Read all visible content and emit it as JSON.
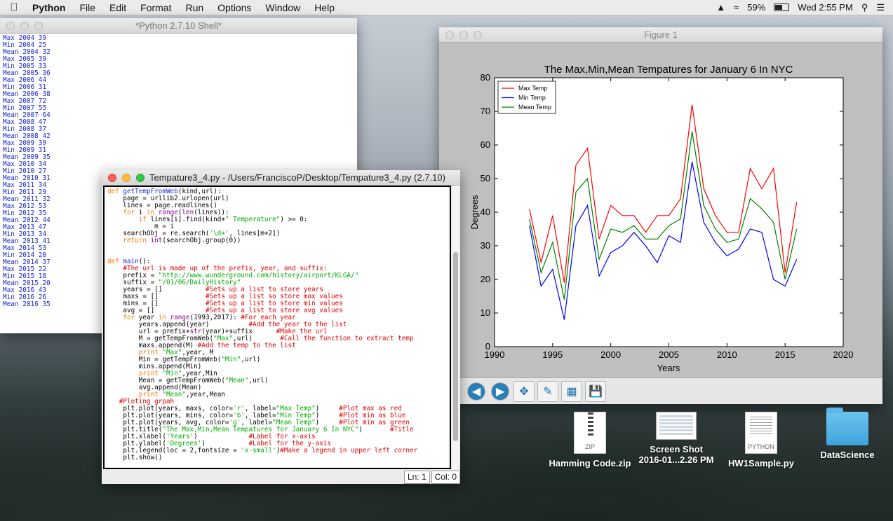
{
  "menubar": {
    "app_name": "Python",
    "items": [
      "File",
      "Edit",
      "Format",
      "Run",
      "Options",
      "Window",
      "Help"
    ],
    "battery": "59%",
    "clock": "Wed 2:55 PM"
  },
  "shell": {
    "title": "*Python 2.7.10 Shell*",
    "lines": [
      "Max 2004 39",
      "Min 2004 25",
      "Mean 2004 32",
      "Max 2005 39",
      "Min 2005 33",
      "Mean 2005 36",
      "Max 2006 44",
      "Min 2006 31",
      "Mean 2006 38",
      "Max 2007 72",
      "Min 2007 55",
      "Mean 2007 64",
      "Max 2008 47",
      "Min 2008 37",
      "Mean 2008 42",
      "Max 2009 39",
      "Min 2009 31",
      "Mean 2009 35",
      "Max 2010 34",
      "Min 2010 27",
      "Mean 2010 31",
      "Max 2011 34",
      "Min 2011 29",
      "Mean 2011 32",
      "Max 2012 53",
      "Min 2012 35",
      "Mean 2012 44",
      "Max 2013 47",
      "Min 2013 34",
      "Mean 2013 41",
      "Max 2014 53",
      "Min 2014 20",
      "Mean 2014 37",
      "Max 2015 22",
      "Min 2015 18",
      "Mean 2015 20",
      "Max 2016 43",
      "Min 2016 26",
      "Mean 2016 35"
    ]
  },
  "editor": {
    "title": "Tempature3_4.py - /Users/FranciscoP/Desktop/Tempature3_4.py (2.7.10)",
    "status_line": "Ln: 1",
    "status_col": "Col: 0",
    "code": [
      [
        [
          "kw",
          "def "
        ],
        [
          "fn",
          "getTempFromWeb"
        ],
        [
          "t",
          "(kind,url):"
        ]
      ],
      [
        [
          "t",
          "    page = urllib2.urlopen(url)"
        ]
      ],
      [
        [
          "t",
          "    lines = page.readlines()"
        ]
      ],
      [
        [
          "t",
          "    "
        ],
        [
          "kw",
          "for"
        ],
        [
          "t",
          " i "
        ],
        [
          "kw",
          "in"
        ],
        [
          "t",
          " "
        ],
        [
          "bi",
          "range"
        ],
        [
          "t",
          "("
        ],
        [
          "bi",
          "len"
        ],
        [
          "t",
          "(lines)):"
        ]
      ],
      [
        [
          "t",
          "        "
        ],
        [
          "kw",
          "if"
        ],
        [
          "t",
          " lines[i].find(kind+"
        ],
        [
          "str",
          "\" Temperature\""
        ],
        [
          "t",
          ") >= 0:"
        ]
      ],
      [
        [
          "t",
          "            m = i"
        ]
      ],
      [
        [
          "t",
          "    searchObj = re.search("
        ],
        [
          "str",
          "'\\d+'"
        ],
        [
          "t",
          ", lines[m+2])"
        ]
      ],
      [
        [
          "t",
          "    "
        ],
        [
          "kw",
          "return"
        ],
        [
          "t",
          " "
        ],
        [
          "bi",
          "int"
        ],
        [
          "t",
          "(searchObj.group(0))"
        ]
      ],
      [
        [
          "t",
          ""
        ]
      ],
      [
        [
          "t",
          ""
        ]
      ],
      [
        [
          "kw",
          "def "
        ],
        [
          "fn",
          "main"
        ],
        [
          "t",
          "():"
        ]
      ],
      [
        [
          "t",
          "    "
        ],
        [
          "cm",
          "#The url is made up of the prefix, year, and suffix:"
        ]
      ],
      [
        [
          "t",
          "    prefix = "
        ],
        [
          "str",
          "\"http://www.wunderground.com/history/airport/KLGA/\""
        ]
      ],
      [
        [
          "t",
          "    suffix = "
        ],
        [
          "str",
          "\"/01/06/DailyHistory\""
        ]
      ],
      [
        [
          "t",
          "    years = []           "
        ],
        [
          "cm",
          "#Sets up a list to store years"
        ]
      ],
      [
        [
          "t",
          "    maxs = []            "
        ],
        [
          "cm",
          "#Sets up a list so store max values"
        ]
      ],
      [
        [
          "t",
          "    mins = []            "
        ],
        [
          "cm",
          "#Sets up a list to store min values"
        ]
      ],
      [
        [
          "t",
          "    avg = []             "
        ],
        [
          "cm",
          "#Sets up a list to store avg values"
        ]
      ],
      [
        [
          "t",
          "    "
        ],
        [
          "kw",
          "for"
        ],
        [
          "t",
          " year "
        ],
        [
          "kw",
          "in"
        ],
        [
          "t",
          " "
        ],
        [
          "bi",
          "range"
        ],
        [
          "t",
          "(1993,2017): "
        ],
        [
          "cm",
          "#For each year"
        ]
      ],
      [
        [
          "t",
          "        years.append(year)          "
        ],
        [
          "cm",
          "#Add the year to the list"
        ]
      ],
      [
        [
          "t",
          "        url = prefix+"
        ],
        [
          "bi",
          "str"
        ],
        [
          "t",
          "(year)+suffix      "
        ],
        [
          "cm",
          "#Make the url"
        ]
      ],
      [
        [
          "t",
          "        M = getTempFromWeb("
        ],
        [
          "str",
          "\"Max\""
        ],
        [
          "t",
          ",url)       "
        ],
        [
          "cm",
          "#Call the function to extract temp"
        ]
      ],
      [
        [
          "t",
          "        maxs.append(M) "
        ],
        [
          "cm",
          "#Add the temp to the list"
        ]
      ],
      [
        [
          "t",
          "        "
        ],
        [
          "kw",
          "print"
        ],
        [
          "t",
          " "
        ],
        [
          "str",
          "\"Max\""
        ],
        [
          "t",
          ",year, M"
        ]
      ],
      [
        [
          "t",
          "        Min = getTempFromWeb("
        ],
        [
          "str",
          "\"Min\""
        ],
        [
          "t",
          ",url)"
        ]
      ],
      [
        [
          "t",
          "        mins.append(Min)"
        ]
      ],
      [
        [
          "t",
          "        "
        ],
        [
          "kw",
          "print"
        ],
        [
          "t",
          " "
        ],
        [
          "str",
          "\"Min\""
        ],
        [
          "t",
          ",year,Min"
        ]
      ],
      [
        [
          "t",
          "        Mean = getTempFromWeb("
        ],
        [
          "str",
          "\"Mean\""
        ],
        [
          "t",
          ",url)"
        ]
      ],
      [
        [
          "t",
          "        avg.append(Mean)"
        ]
      ],
      [
        [
          "t",
          "        "
        ],
        [
          "kw",
          "print"
        ],
        [
          "t",
          " "
        ],
        [
          "str",
          "\"Mean\""
        ],
        [
          "t",
          ",year,Mean"
        ]
      ],
      [
        [
          "t",
          "   "
        ],
        [
          "cm",
          "#Ploting grpah"
        ]
      ],
      [
        [
          "t",
          "    plt.plot(years, maxs, color="
        ],
        [
          "str",
          "'r'"
        ],
        [
          "t",
          ", label="
        ],
        [
          "str",
          "\"Max Temp\""
        ],
        [
          "t",
          ")     "
        ],
        [
          "cm",
          "#Plot max as red"
        ]
      ],
      [
        [
          "t",
          "    plt.plot(years, mins, color="
        ],
        [
          "str",
          "'b'"
        ],
        [
          "t",
          ", label="
        ],
        [
          "str",
          "\"Min Temp\""
        ],
        [
          "t",
          ")     "
        ],
        [
          "cm",
          "#Plot min as blue"
        ]
      ],
      [
        [
          "t",
          "    plt.plot(years, avg, color="
        ],
        [
          "str",
          "'g'"
        ],
        [
          "t",
          ", label="
        ],
        [
          "str",
          "\"Mean Temp\""
        ],
        [
          "t",
          ")     "
        ],
        [
          "cm",
          "#Plot min as green"
        ]
      ],
      [
        [
          "t",
          "    plt.title("
        ],
        [
          "str",
          "\"The Max,Min,Mean Tempatures for January 6 In NYC\""
        ],
        [
          "t",
          ")       "
        ],
        [
          "cm",
          "#Title"
        ]
      ],
      [
        [
          "t",
          "    plt.xlabel("
        ],
        [
          "str",
          "'Years'"
        ],
        [
          "t",
          ")             "
        ],
        [
          "cm",
          "#Label for x-axis"
        ]
      ],
      [
        [
          "t",
          "    plt.ylabel("
        ],
        [
          "str",
          "'Degrees'"
        ],
        [
          "t",
          ")           "
        ],
        [
          "cm",
          "#Label for the y-axis"
        ]
      ],
      [
        [
          "t",
          "    plt.legend(loc = 2,fontsize = "
        ],
        [
          "str",
          "'x-small'"
        ],
        [
          "t",
          ")"
        ],
        [
          "cm",
          "#Make a legend in upper left corner"
        ]
      ],
      [
        [
          "t",
          "    plt.show()"
        ]
      ]
    ]
  },
  "figure": {
    "title": "Figure 1",
    "toolbar": [
      "home-icon",
      "back-icon",
      "forward-icon",
      "pan-icon",
      "zoom-icon",
      "subplots-icon",
      "save-icon"
    ]
  },
  "chart_data": {
    "type": "line",
    "title": "The Max,Min,Mean Tempatures for January 6 In NYC",
    "xlabel": "Years",
    "ylabel": "Degrees",
    "xlim": [
      1990,
      2020
    ],
    "ylim": [
      0,
      80
    ],
    "xticks": [
      1990,
      1995,
      2000,
      2005,
      2010,
      2015,
      2020
    ],
    "yticks": [
      0,
      10,
      20,
      30,
      40,
      50,
      60,
      70,
      80
    ],
    "legend_loc": "top-left",
    "x": [
      1993,
      1994,
      1995,
      1996,
      1997,
      1998,
      1999,
      2000,
      2001,
      2002,
      2003,
      2004,
      2005,
      2006,
      2007,
      2008,
      2009,
      2010,
      2011,
      2012,
      2013,
      2014,
      2015,
      2016
    ],
    "series": [
      {
        "name": "Max Temp",
        "color": "#ff0000",
        "values": [
          41,
          25,
          39,
          19,
          54,
          59,
          32,
          42,
          39,
          39,
          34,
          39,
          39,
          44,
          72,
          47,
          39,
          34,
          34,
          53,
          47,
          53,
          22,
          43
        ]
      },
      {
        "name": "Min Temp",
        "color": "#0000ff",
        "values": [
          36,
          18,
          23,
          8,
          36,
          42,
          21,
          28,
          30,
          34,
          30,
          25,
          33,
          31,
          55,
          37,
          31,
          27,
          29,
          35,
          34,
          20,
          18,
          26
        ]
      },
      {
        "name": "Mean Temp",
        "color": "#008000",
        "values": [
          38,
          22,
          31,
          14,
          46,
          50,
          26,
          35,
          34,
          36,
          32,
          32,
          36,
          38,
          64,
          42,
          35,
          31,
          32,
          44,
          41,
          37,
          20,
          35
        ]
      }
    ]
  },
  "desktop": {
    "icons": [
      {
        "label": "Hamming Code.zip",
        "tag": "ZIP",
        "kind": "zip-icon"
      },
      {
        "label": "Screen Shot",
        "label2": "2016-01...2.26 PM",
        "kind": "screenshot-icon"
      },
      {
        "label": "HW1Sample.py",
        "tag": "PYTHON",
        "kind": "python-file-icon"
      },
      {
        "label": "DataScience",
        "kind": "folder-icon"
      }
    ]
  }
}
